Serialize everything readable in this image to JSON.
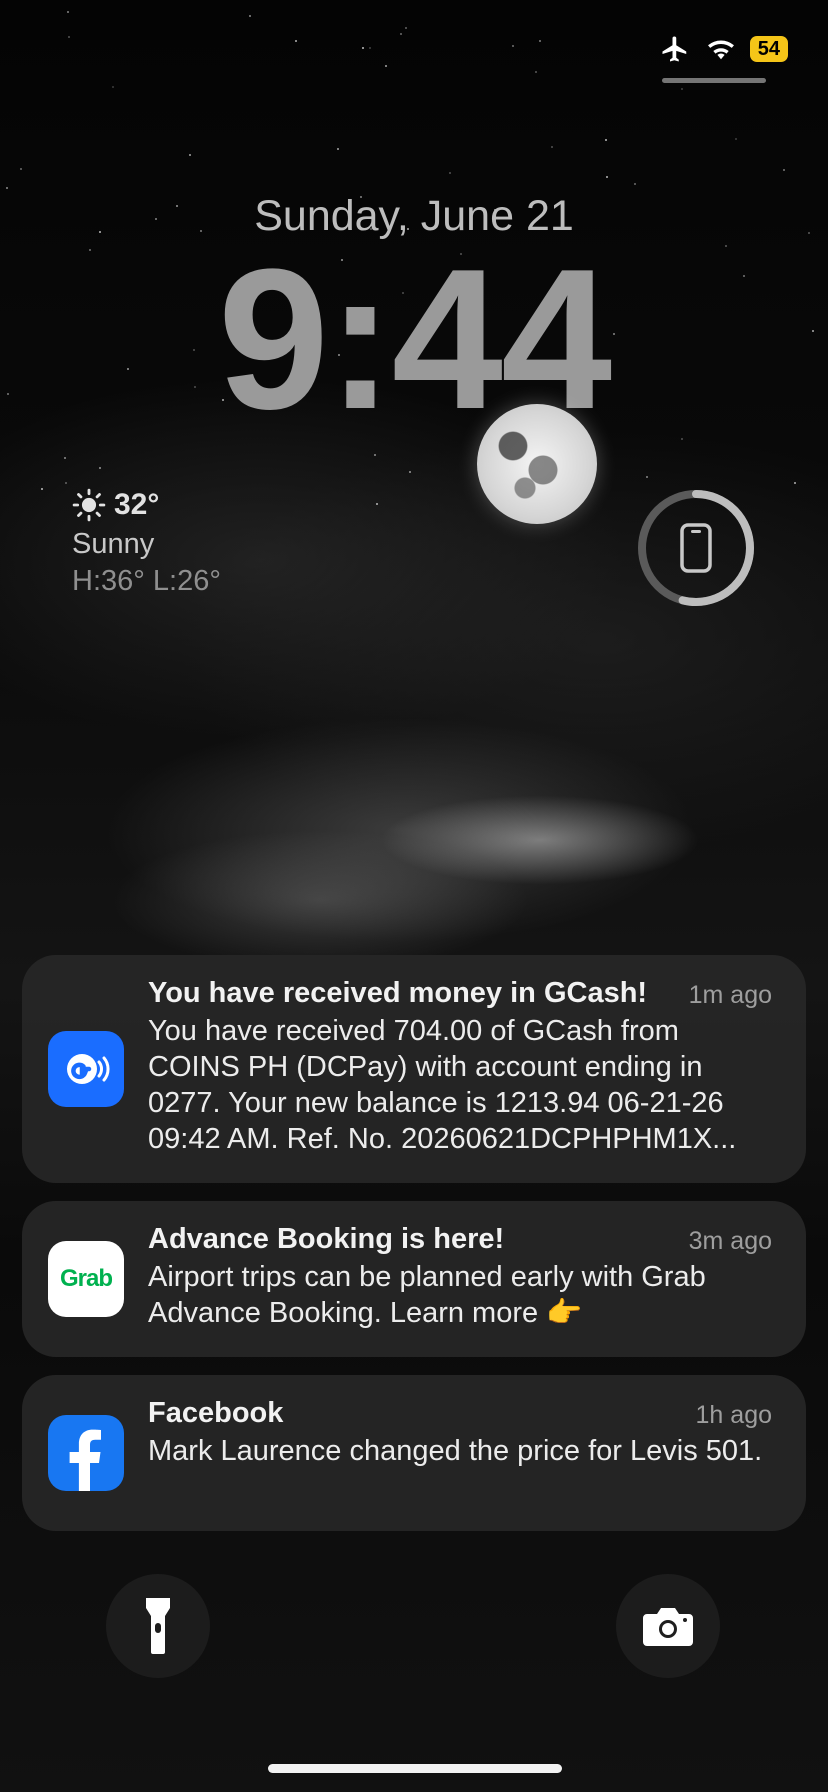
{
  "status_bar": {
    "airplane_icon": "airplane-icon",
    "wifi_icon": "wifi-icon",
    "battery_level": "54",
    "battery_color": "#f5c518"
  },
  "lockscreen": {
    "date": "Sunday, June 21",
    "time": "9:44"
  },
  "weather": {
    "temperature": "32°",
    "condition": "Sunny",
    "high_low": "H:36° L:26°",
    "icon": "sun-icon"
  },
  "battery_widget": {
    "icon": "phone-icon"
  },
  "notifications": [
    {
      "app": "GCash",
      "icon": "gcash-icon",
      "title": "You have received money in GCash!",
      "time": "1m ago",
      "body": "You have received 704.00 of GCash from COINS PH (DCPay) with account ending in 0277. Your new balance is 1213.94 06-21-26 09:42 AM. Ref. No. 20260621DCPHPHM1X..."
    },
    {
      "app": "Grab",
      "icon": "grab-icon",
      "logo_text": "Grab",
      "title": "Advance Booking is here!",
      "time": "3m ago",
      "body": "Airport trips can be planned early with Grab Advance Booking. Learn more 👉"
    },
    {
      "app": "Facebook",
      "icon": "facebook-icon",
      "title": "Facebook",
      "time": "1h ago",
      "body": "Mark Laurence changed the price for Levis 501."
    }
  ],
  "quick_actions": {
    "flashlight_icon": "flashlight-icon",
    "camera_icon": "camera-icon"
  }
}
